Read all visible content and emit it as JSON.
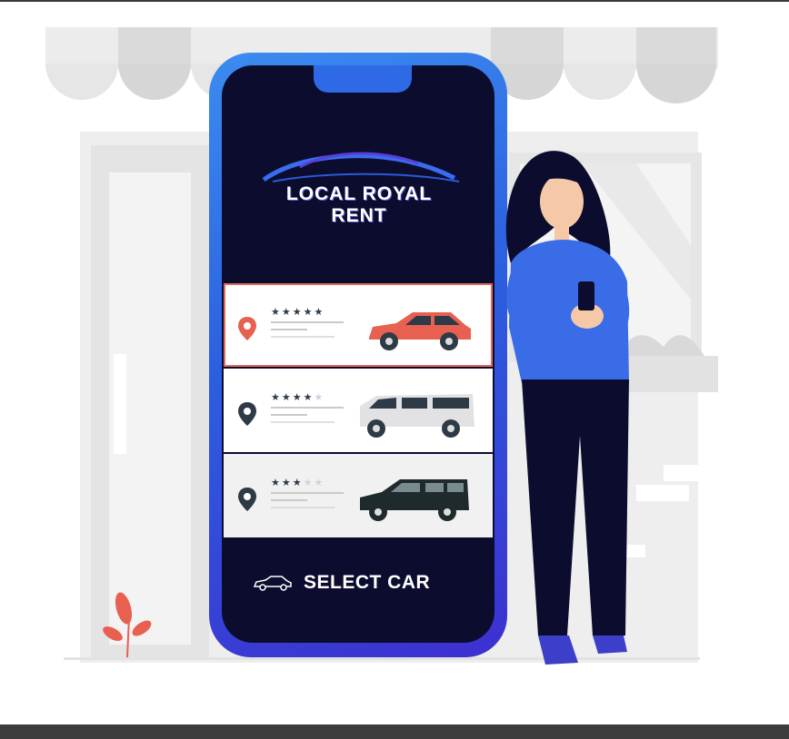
{
  "brand": {
    "line1": "LOCAL ROYAL",
    "line2": "RENT"
  },
  "car_list": [
    {
      "rating": 5,
      "max_rating": 5,
      "selected": true,
      "car_color": "#e8604f",
      "car_type": "suv",
      "pin_color": "#e8604f"
    },
    {
      "rating": 4,
      "max_rating": 5,
      "selected": false,
      "car_color": "#e2e2e4",
      "car_type": "van",
      "pin_color": "#2f3a47"
    },
    {
      "rating": 3,
      "max_rating": 5,
      "selected": false,
      "car_color": "#1f2a2c",
      "car_type": "jeep",
      "pin_color": "#2f3a47"
    }
  ],
  "select_button": {
    "label": "SELECT CAR",
    "icon": "car-outline-icon"
  },
  "colors": {
    "accent": "#3b6ce8",
    "screen_bg": "#0c0d2e",
    "highlight": "#e06b5a"
  }
}
